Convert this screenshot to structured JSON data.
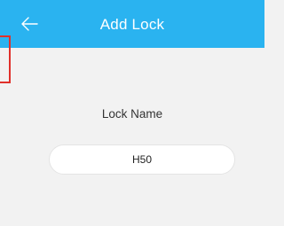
{
  "header": {
    "title": "Add Lock",
    "back_icon": "arrow-left-icon",
    "background": "#2ab3f0"
  },
  "form": {
    "label": "Lock Name",
    "value": "H50"
  },
  "colors": {
    "accent": "#2ab3f0",
    "background": "#f2f2f2",
    "marker": "#e0302a"
  }
}
